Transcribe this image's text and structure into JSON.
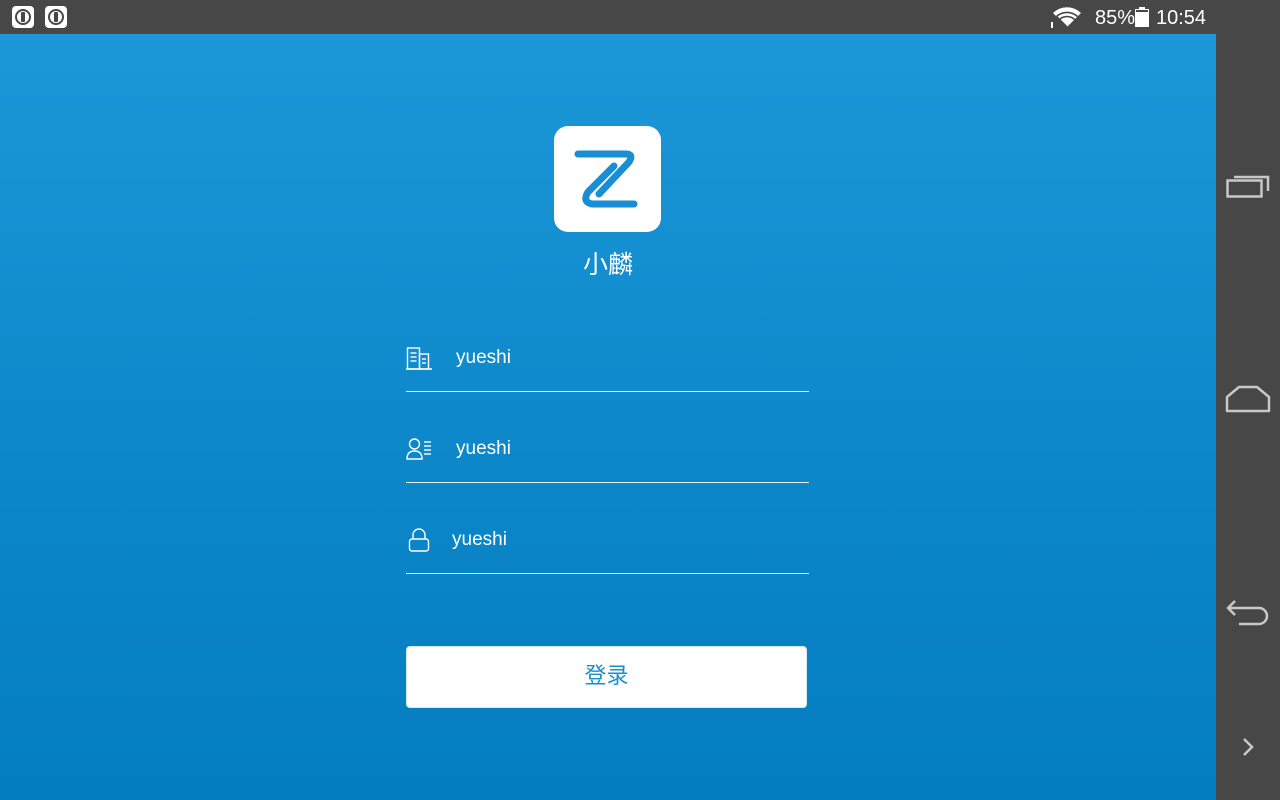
{
  "status_bar": {
    "battery": "85%",
    "time": "10:54",
    "notification_icons": [
      "key-icon",
      "key-icon"
    ],
    "wifi_icon": "wifi-icon",
    "battery_icon": "battery-icon"
  },
  "app": {
    "name": "小麟",
    "logo_icon": "z-logo-icon",
    "colors": {
      "background_top": "#1c97d8",
      "background_bottom": "#047ec0",
      "accent": "#1a8ed3"
    }
  },
  "form": {
    "company": {
      "value": "yueshi",
      "icon": "building-icon"
    },
    "username": {
      "value": "yueshi",
      "icon": "user-list-icon"
    },
    "password": {
      "value": "yueshi",
      "icon": "lock-icon"
    },
    "login_label": "登录"
  },
  "nav_bar": {
    "items": [
      "recent-apps-icon",
      "home-icon",
      "back-icon",
      "chevron-right-icon"
    ]
  }
}
